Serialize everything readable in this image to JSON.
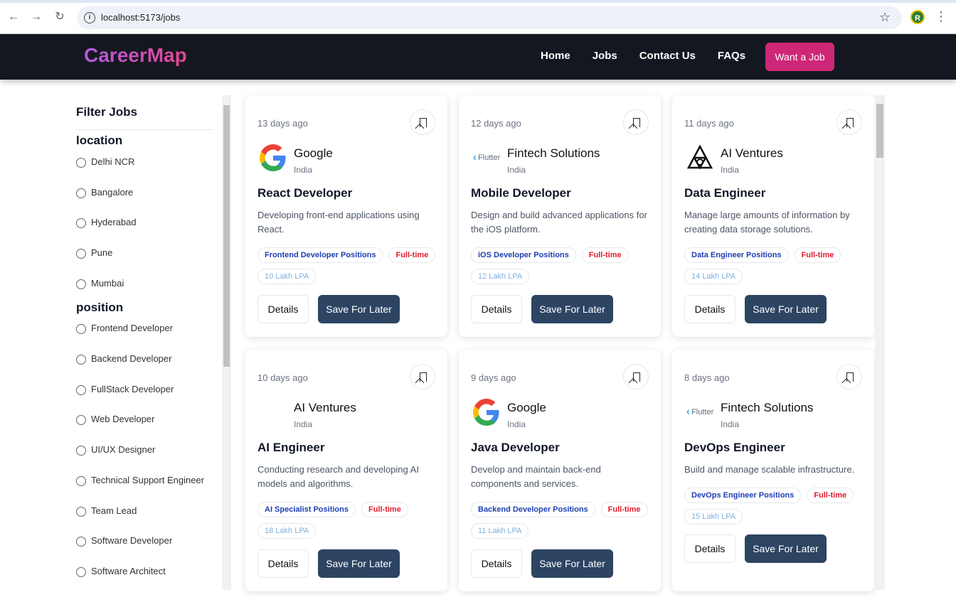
{
  "browser": {
    "url": "localhost:5173/jobs",
    "profile_initial": "R"
  },
  "header": {
    "brand": "CareerMap",
    "nav": [
      "Home",
      "Jobs",
      "Contact Us",
      "FAQs"
    ],
    "cta": "Want a Job"
  },
  "sidebar": {
    "title": "Filter Jobs",
    "location_title": "location",
    "locations": [
      "Delhi NCR",
      "Bangalore",
      "Hyderabad",
      "Pune",
      "Mumbai"
    ],
    "position_title": "position",
    "positions": [
      "Frontend Developer",
      "Backend Developer",
      "FullStack Developer",
      "Web Developer",
      "UI/UX Designer",
      "Technical Support Engineer",
      "Team Lead",
      "Software Developer",
      "Software Architect"
    ]
  },
  "jobs": [
    {
      "days": "13 days ago",
      "company": "Google",
      "logo": "google-logo",
      "location": "India",
      "title": "React Developer",
      "desc": "Developing front-end applications using React.",
      "position_badge": "Frontend Developer Positions",
      "type_badge": "Full-time",
      "salary": "10 Lakh LPA"
    },
    {
      "days": "12 days ago",
      "company": "Fintech Solutions",
      "logo": "flutter-logo",
      "location": "India",
      "title": "Mobile Developer",
      "desc": "Design and build advanced applications for the iOS platform.",
      "position_badge": "iOS Developer Positions",
      "type_badge": "Full-time",
      "salary": "12 Lakh LPA"
    },
    {
      "days": "11 days ago",
      "company": "AI Ventures",
      "logo": "ai-ventures-logo",
      "location": "India",
      "title": "Data Engineer",
      "desc": "Manage large amounts of information by creating data storage solutions.",
      "position_badge": "Data Engineer Positions",
      "type_badge": "Full-time",
      "salary": "14 Lakh LPA"
    },
    {
      "days": "10 days ago",
      "company": "AI Ventures",
      "logo": "",
      "location": "India",
      "title": "AI Engineer",
      "desc": "Conducting research and developing AI models and algorithms.",
      "position_badge": "AI Specialist Positions",
      "type_badge": "Full-time",
      "salary": "18 Lakh LPA"
    },
    {
      "days": "9 days ago",
      "company": "Google",
      "logo": "google-logo",
      "location": "India",
      "title": "Java Developer",
      "desc": "Develop and maintain back-end components and services.",
      "position_badge": "Backend Developer Positions",
      "type_badge": "Full-time",
      "salary": "11 Lakh LPA"
    },
    {
      "days": "8 days ago",
      "company": "Fintech Solutions",
      "logo": "flutter-logo",
      "location": "India",
      "title": "DevOps Engineer",
      "desc": "Build and manage scalable infrastructure.",
      "position_badge": "DevOps Engineer Positions",
      "type_badge": "Full-time",
      "salary": "15 Lakh LPA"
    }
  ],
  "labels": {
    "details": "Details",
    "save": "Save For Later",
    "flutter": "Flutter"
  },
  "colors": {
    "appbar": "#14171f",
    "cta": "#cf2778",
    "save_button": "#2d4463"
  }
}
